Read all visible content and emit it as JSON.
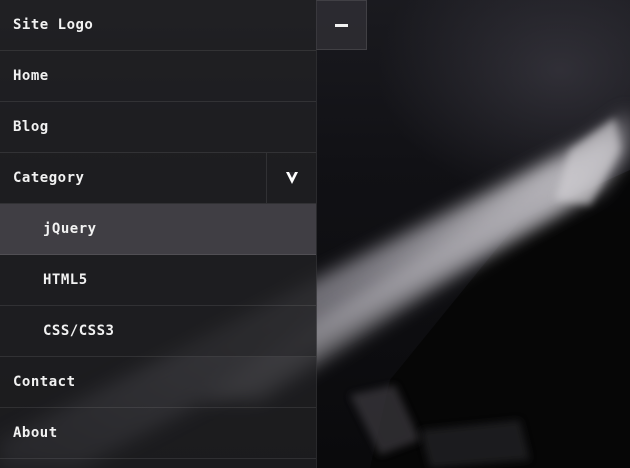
{
  "header": {
    "logo_text": "Site Logo",
    "toggle_icon": "minus-icon"
  },
  "menu": {
    "items": [
      {
        "label": "Home"
      },
      {
        "label": "Blog"
      },
      {
        "label": "Category",
        "expanded": true,
        "toggle_icon": "chevron-down-icon"
      },
      {
        "label": "Contact"
      },
      {
        "label": "About"
      }
    ],
    "submenu": [
      {
        "label": "jQuery",
        "active": true
      },
      {
        "label": "HTML5"
      },
      {
        "label": "CSS/CSS3"
      }
    ]
  },
  "colors": {
    "text": "#f2f2f2",
    "panel": "#232226",
    "active_item": "#5c5a62"
  }
}
